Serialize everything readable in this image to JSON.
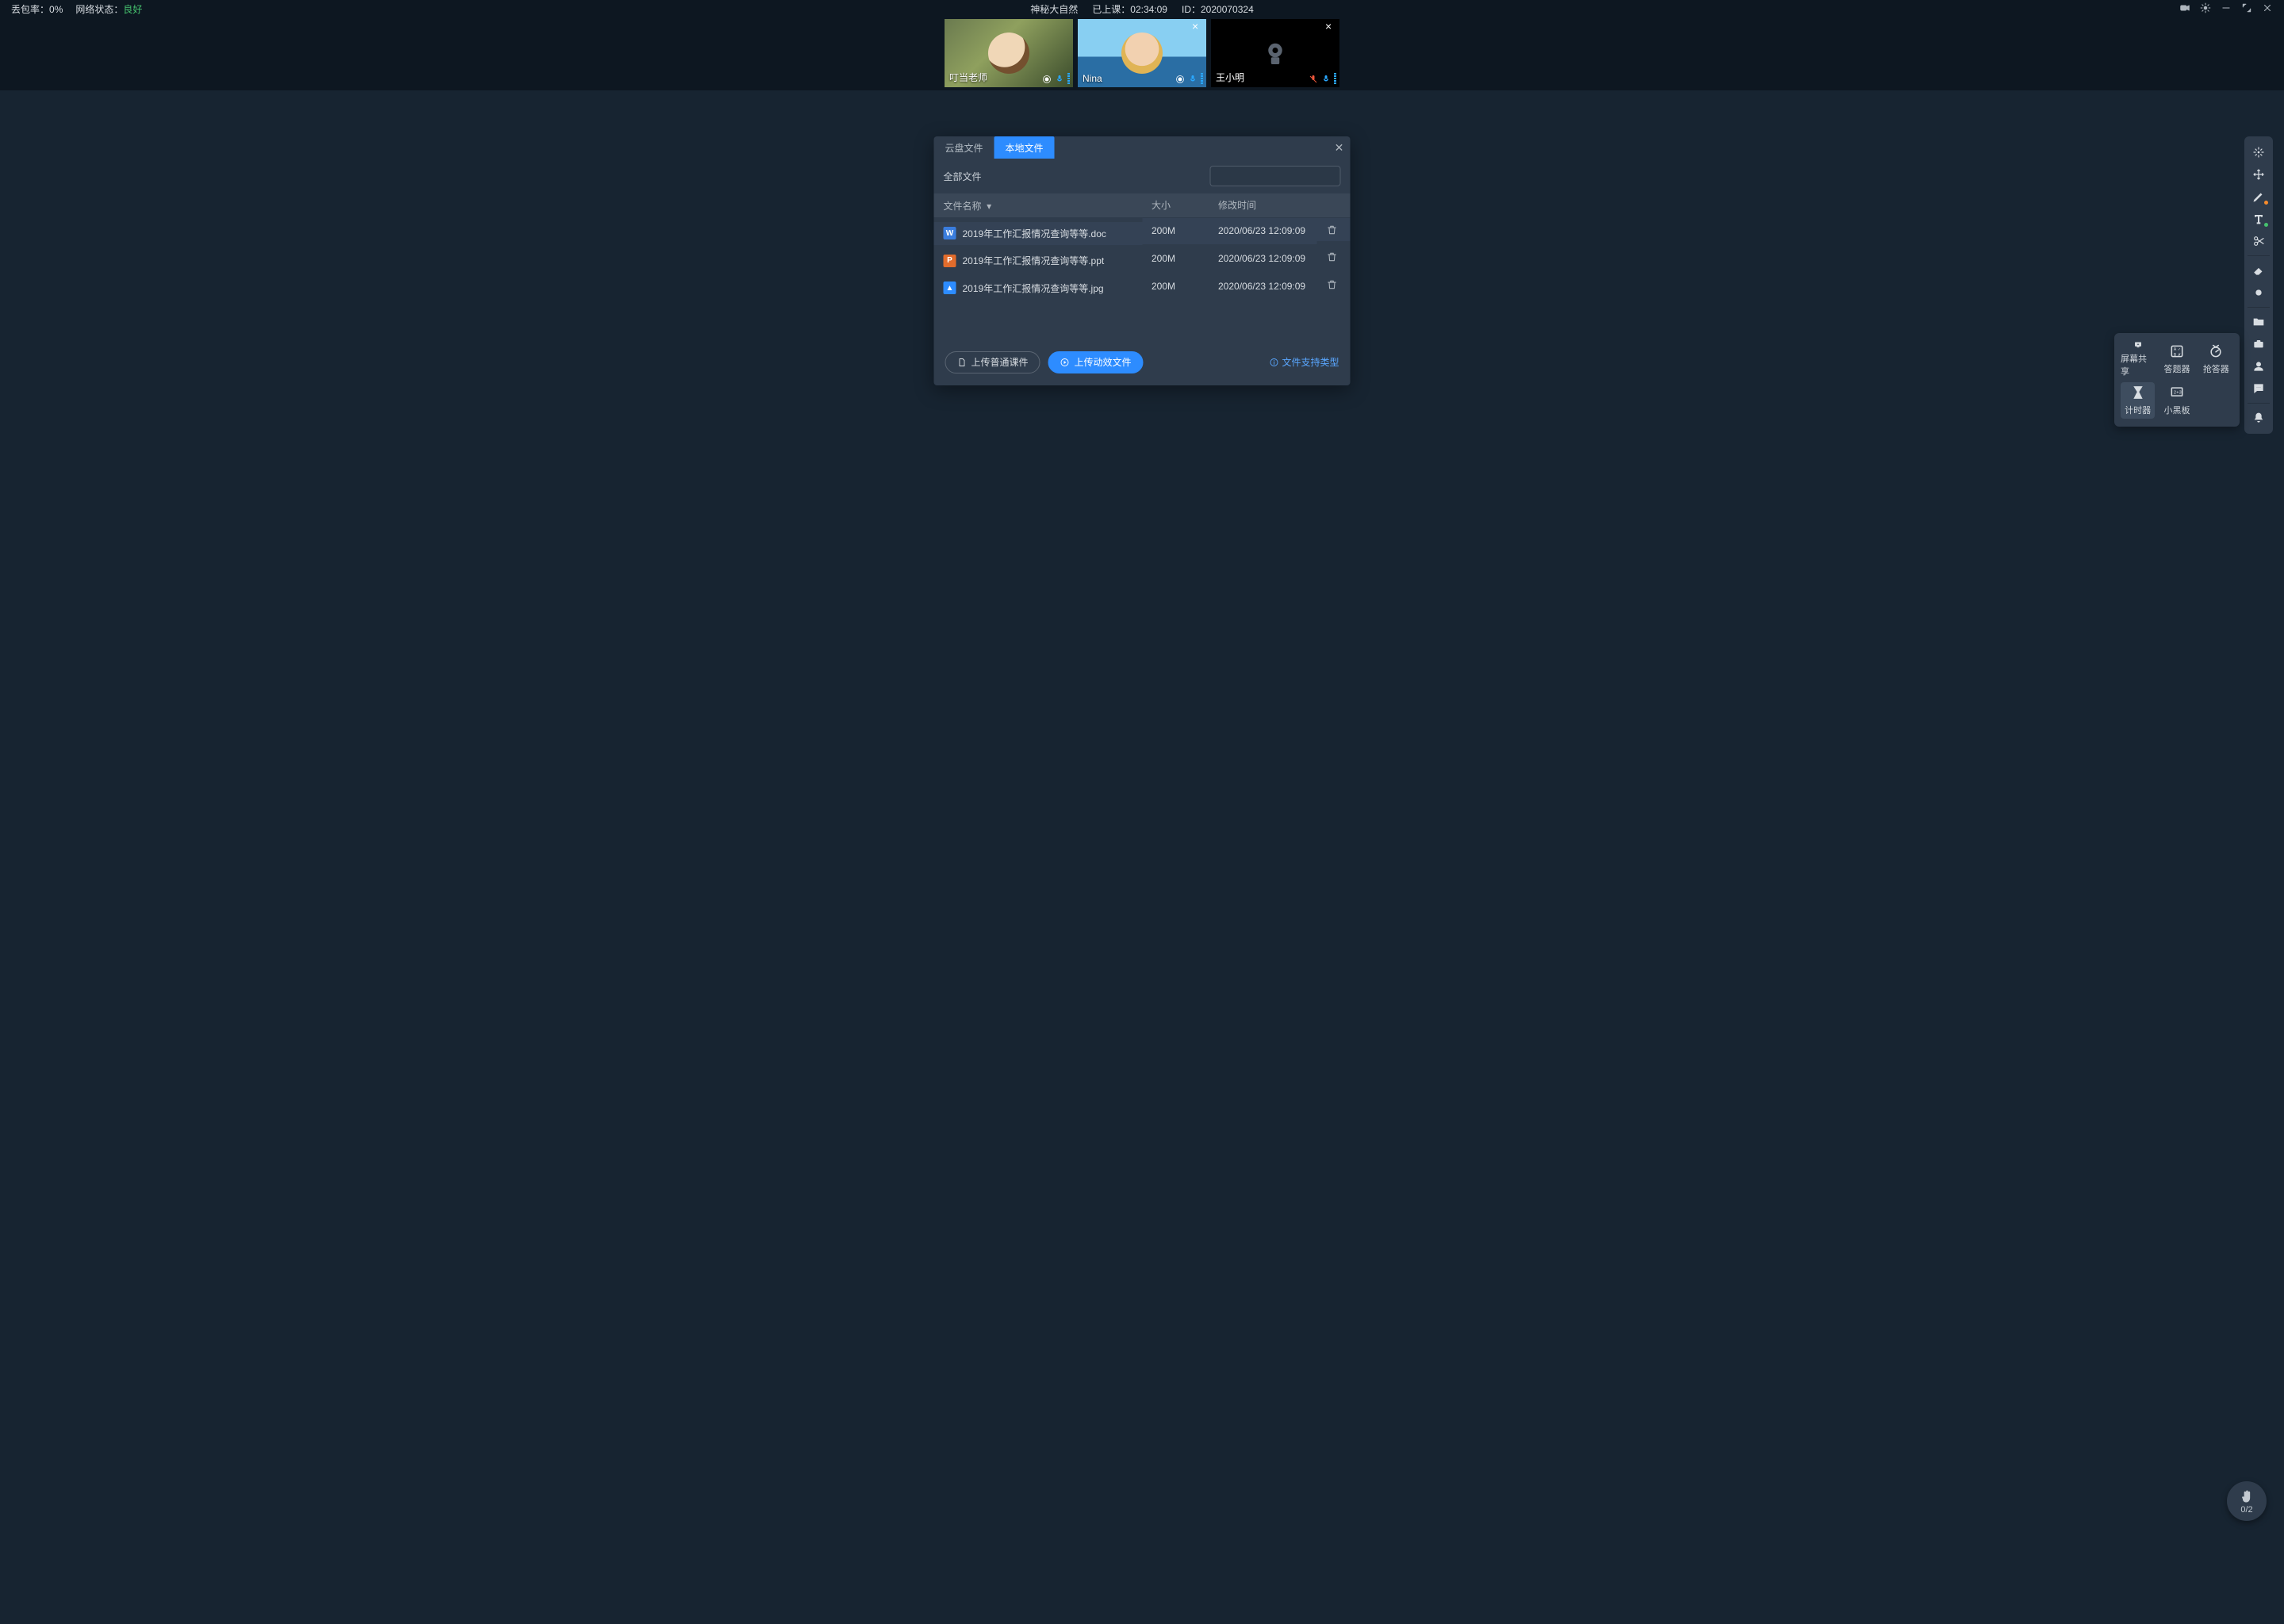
{
  "topbar": {
    "loss_label": "丢包率：",
    "loss_value": "0%",
    "network_label": "网络状态：",
    "network_value": "良好",
    "course_title": "神秘大自然",
    "elapsed_label": "已上课：",
    "elapsed_value": "02:34:09",
    "id_label": "ID：",
    "id_value": "2020070324"
  },
  "participants": [
    {
      "name": "叮当老师",
      "camera_off": false,
      "mic_muted": false,
      "closable": false
    },
    {
      "name": "Nina",
      "camera_off": false,
      "mic_muted": false,
      "closable": true
    },
    {
      "name": "王小明",
      "camera_off": true,
      "mic_muted": true,
      "closable": true
    }
  ],
  "dialog": {
    "tabs": {
      "cloud": "云盘文件",
      "local": "本地文件"
    },
    "active_tab": "local",
    "path_label": "全部文件",
    "search_placeholder": "",
    "columns": {
      "name": "文件名称",
      "size": "大小",
      "mtime": "修改时间"
    },
    "files": [
      {
        "icon": "doc",
        "letter": "W",
        "name": "2019年工作汇报情况查询等等.doc",
        "size": "200M",
        "mtime": "2020/06/23 12:09:09"
      },
      {
        "icon": "ppt",
        "letter": "P",
        "name": "2019年工作汇报情况查询等等.ppt",
        "size": "200M",
        "mtime": "2020/06/23 12:09:09"
      },
      {
        "icon": "img",
        "letter": "▲",
        "name": "2019年工作汇报情况查询等等.jpg",
        "size": "200M",
        "mtime": "2020/06/23 12:09:09"
      }
    ],
    "upload_plain": "上传普通课件",
    "upload_dynamic": "上传动效文件",
    "supported_link": "文件支持类型"
  },
  "tool_panel": {
    "items": [
      {
        "id": "screen-share",
        "label": "屏幕共享"
      },
      {
        "id": "answer-board",
        "label": "答题器"
      },
      {
        "id": "buzzer",
        "label": "抢答器"
      },
      {
        "id": "timer",
        "label": "计时器"
      },
      {
        "id": "mini-board",
        "label": "小黑板"
      }
    ],
    "active": "timer"
  },
  "hand_raise": {
    "count": "0/2"
  }
}
